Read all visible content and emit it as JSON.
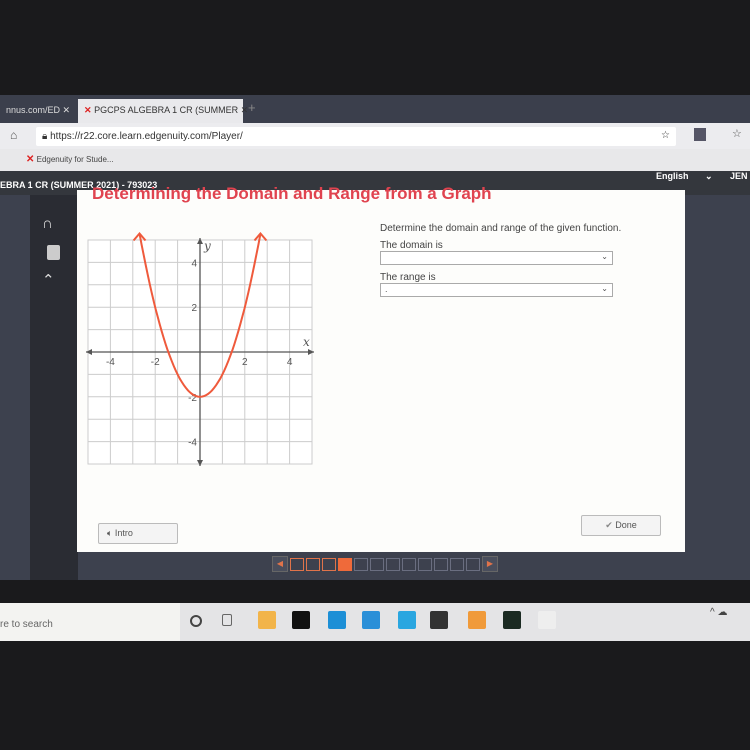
{
  "browser": {
    "tabs": [
      {
        "label": "nnus.com/ED",
        "active": false
      },
      {
        "label": "PGCPS ALGEBRA 1 CR (SUMMER",
        "active": true
      }
    ],
    "url": "https://r22.core.learn.edgenuity.com/Player/",
    "bookmark": "Edgenuity for Stude..."
  },
  "app": {
    "course": "EBRA 1 CR (SUMMER 2021) - 793023",
    "language": "English",
    "user": "JEN"
  },
  "lesson": {
    "title": "Determining the Domain and Range from a Graph",
    "prompt": "Determine the domain and range of the given function.",
    "domain_label": "The domain is",
    "domain_value": "",
    "range_label": "The range is",
    "range_value": ".",
    "intro_label": "Intro",
    "done_label": "Done"
  },
  "graph": {
    "x_label": "x",
    "y_label": "y",
    "x_ticks": [
      "-4",
      "-2",
      "2",
      "4"
    ],
    "y_ticks": [
      "4",
      "2",
      "-2",
      "-4"
    ],
    "x_range": [
      -5,
      5
    ],
    "y_range": [
      -5,
      5
    ],
    "function": "y = x^2 - 2",
    "curve_x_range": [
      -2.7,
      2.7
    ],
    "curve_color": "#ef5a3c"
  },
  "progress": {
    "total": 12,
    "completed": 3,
    "current": 4
  },
  "taskbar": {
    "search_placeholder": "re to search",
    "apps": [
      "cortana",
      "task-view",
      "file-explorer",
      "netflix",
      "edge",
      "mail",
      "l-app",
      "store",
      "game",
      "hulu",
      "itunes"
    ]
  }
}
